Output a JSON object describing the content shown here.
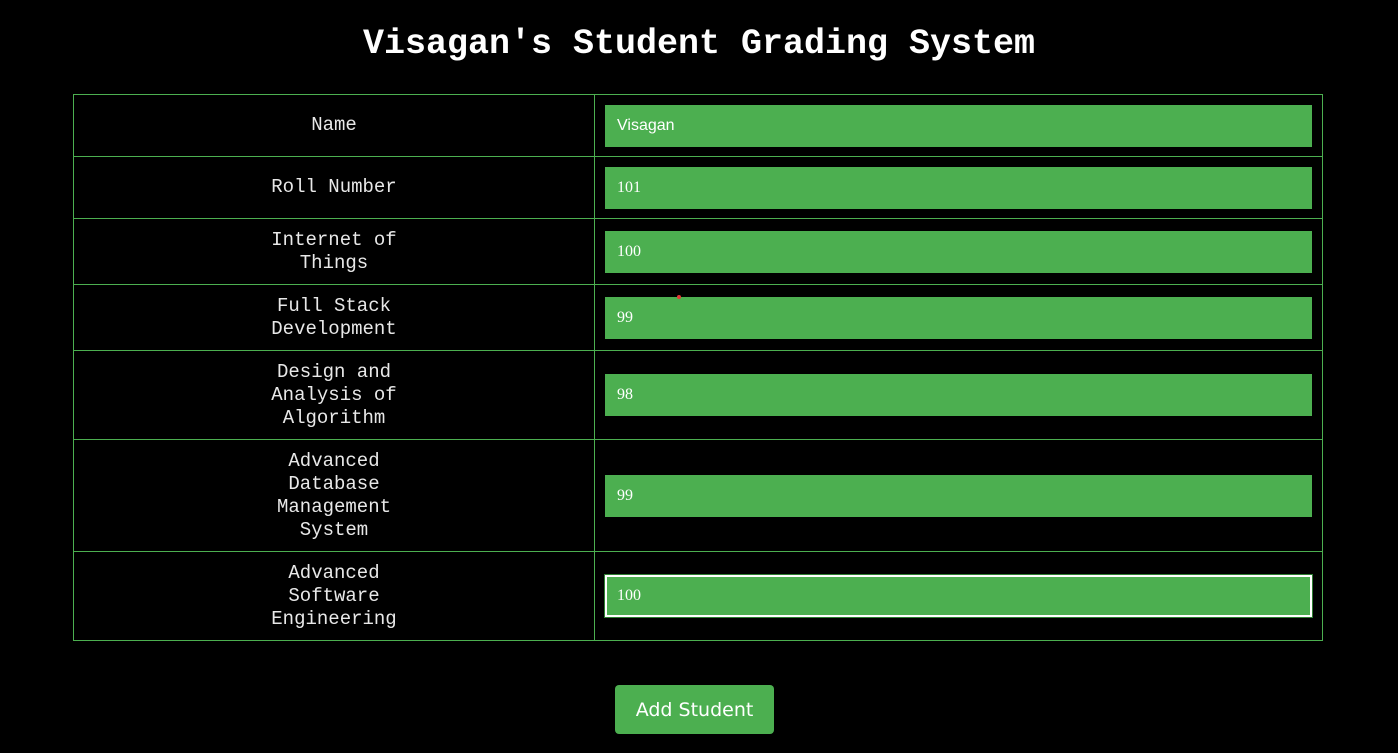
{
  "title": "Visagan's Student Grading System",
  "fields": [
    {
      "label": "Name",
      "value": "Visagan"
    },
    {
      "label": "Roll Number",
      "value": "101"
    },
    {
      "label": "Internet of Things",
      "value": "100"
    },
    {
      "label": "Full Stack Development",
      "value": "99"
    },
    {
      "label": "Design and Analysis of Algorithm",
      "value": "98"
    },
    {
      "label": "Advanced Database Management System",
      "value": "99"
    },
    {
      "label": "Advanced Software Engineering",
      "value": "100"
    }
  ],
  "add_button_label": "Add Student",
  "colors": {
    "background": "#000000",
    "accent": "#4caf50",
    "text": "#ffffff"
  }
}
